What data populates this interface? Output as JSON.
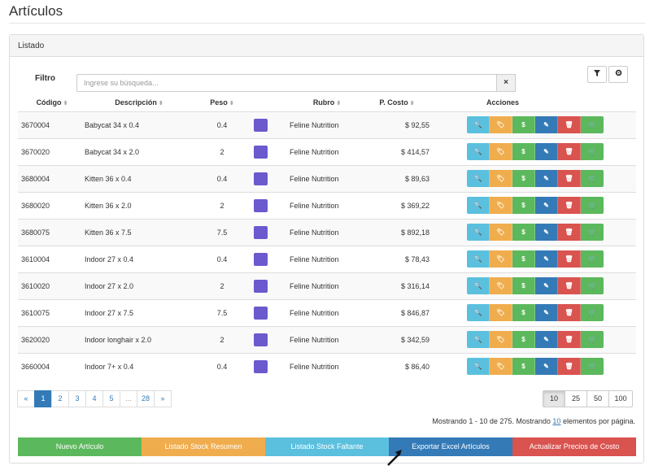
{
  "page": {
    "title": "Artículos"
  },
  "panel": {
    "heading": "Listado"
  },
  "filter": {
    "label": "Filtro",
    "placeholder": "Ingrese su búsqueda...",
    "clear_icon": "×"
  },
  "tools": {
    "filter_icon": "filter-icon",
    "settings_icon": "gear-icon"
  },
  "table": {
    "headers": [
      "Código",
      "Descripción",
      "Peso",
      "",
      "Rubro",
      "P. Costo",
      "Acciones"
    ],
    "rows": [
      {
        "code": "3670004",
        "desc": "Babycat 34 x 0.4",
        "peso": "0.4",
        "rubro": "Feline Nutrition",
        "costo": "$ 92,55"
      },
      {
        "code": "3670020",
        "desc": "Babycat 34 x 2.0",
        "peso": "2",
        "rubro": "Feline Nutrition",
        "costo": "$ 414,57"
      },
      {
        "code": "3680004",
        "desc": "Kitten 36 x 0.4",
        "peso": "0.4",
        "rubro": "Feline Nutrition",
        "costo": "$ 89,63"
      },
      {
        "code": "3680020",
        "desc": "Kitten 36 x 2.0",
        "peso": "2",
        "rubro": "Feline Nutrition",
        "costo": "$ 369,22"
      },
      {
        "code": "3680075",
        "desc": "Kitten 36 x 7.5",
        "peso": "7.5",
        "rubro": "Feline Nutrition",
        "costo": "$ 892,18"
      },
      {
        "code": "3610004",
        "desc": "Indoor 27 x 0.4",
        "peso": "0.4",
        "rubro": "Feline Nutrition",
        "costo": "$ 78,43"
      },
      {
        "code": "3610020",
        "desc": "Indoor 27 x 2.0",
        "peso": "2",
        "rubro": "Feline Nutrition",
        "costo": "$ 316,14"
      },
      {
        "code": "3610075",
        "desc": "Indoor 27 x 7.5",
        "peso": "7.5",
        "rubro": "Feline Nutrition",
        "costo": "$ 846,87"
      },
      {
        "code": "3620020",
        "desc": "Indoor longhair x 2.0",
        "peso": "2",
        "rubro": "Feline Nutrition",
        "costo": "$ 342,59"
      },
      {
        "code": "3660004",
        "desc": "Indoor 7+ x 0.4",
        "peso": "0.4",
        "rubro": "Feline Nutrition",
        "costo": "$ 86,40"
      }
    ],
    "swatch_color": "#6a5acd",
    "actions": [
      {
        "name": "view",
        "icon": "search-icon",
        "glyph": "🔍",
        "color": "#5bc0de"
      },
      {
        "name": "tags",
        "icon": "tag-icon",
        "glyph": "🏷",
        "color": "#f0ad4e"
      },
      {
        "name": "price",
        "icon": "dollar-icon",
        "glyph": "$",
        "color": "#5cb85c"
      },
      {
        "name": "edit",
        "icon": "pencil-icon",
        "glyph": "✎",
        "color": "#337ab7"
      },
      {
        "name": "delete",
        "icon": "trash-icon",
        "glyph": "🗑",
        "color": "#d9534f"
      },
      {
        "name": "cart",
        "icon": "cart-icon",
        "glyph": "🛒",
        "color": "#5cb85c"
      }
    ]
  },
  "pagination": {
    "pages": [
      "«",
      "1",
      "2",
      "3",
      "4",
      "5",
      "...",
      "28",
      "»"
    ],
    "active": "1",
    "page_sizes": [
      "10",
      "25",
      "50",
      "100"
    ],
    "active_size": "10"
  },
  "summary": {
    "prefix": "Mostrando 1 - 10 de 275. Mostrando ",
    "link": "10",
    "suffix": " elementos por página."
  },
  "bottom_buttons": [
    {
      "label": "Nuevo Artículo",
      "color": "#5cb85c"
    },
    {
      "label": "Listado Stock Resumen",
      "color": "#f0ad4e"
    },
    {
      "label": "Listado Stock Faltante",
      "color": "#5bc0de"
    },
    {
      "label": "Exportar Excel Artículos",
      "color": "#337ab7"
    },
    {
      "label": "Actualizar Precios de Costo",
      "color": "#d9534f"
    }
  ]
}
